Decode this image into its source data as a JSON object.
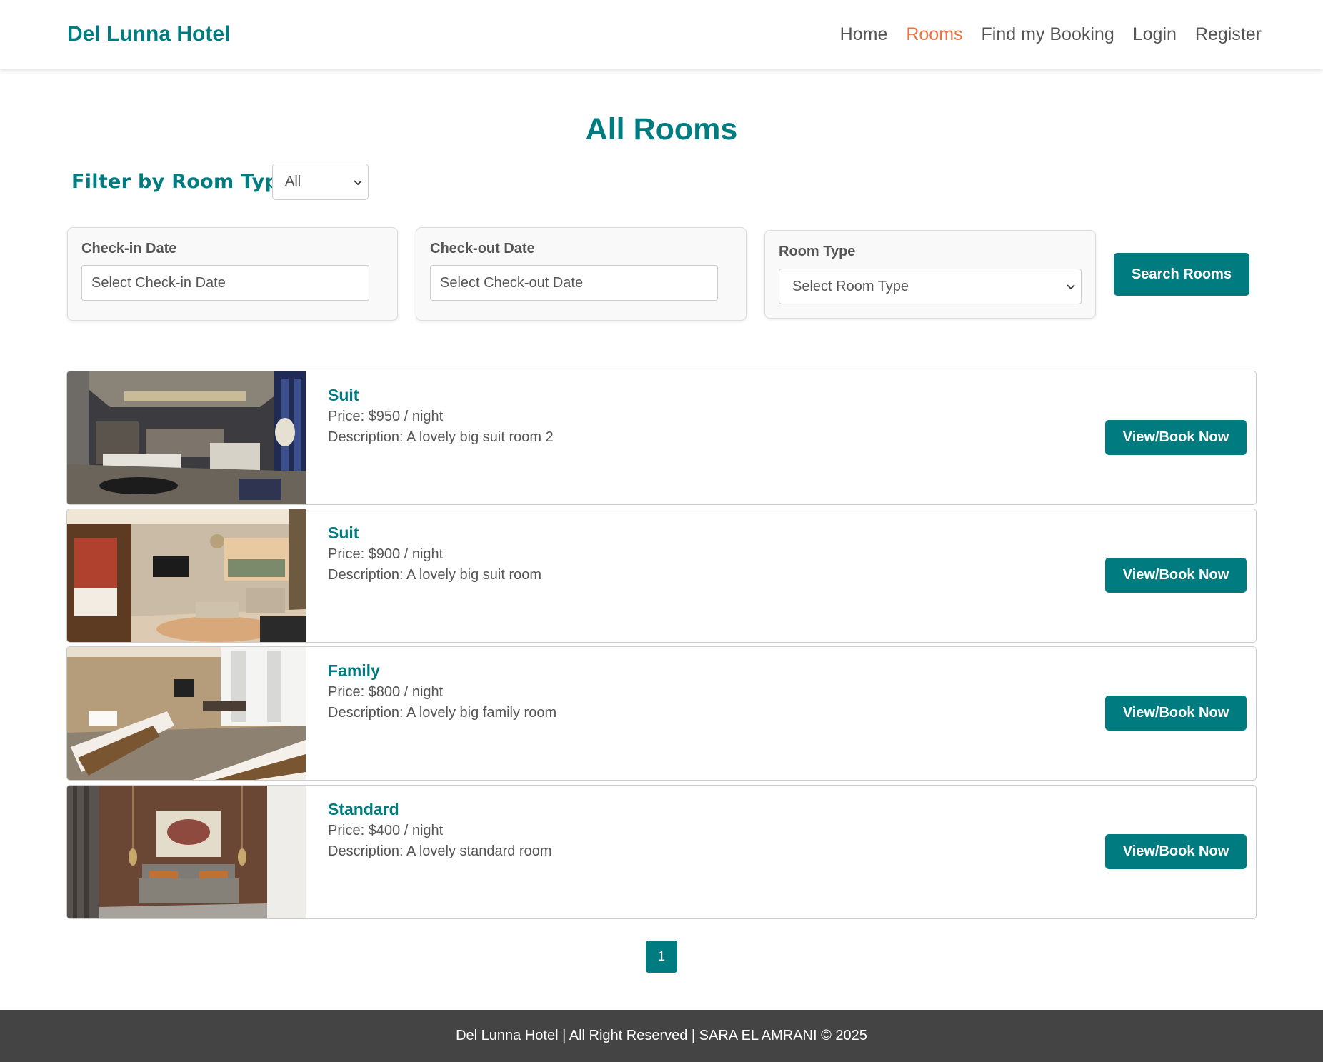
{
  "navbar": {
    "brand": "Del Lunna Hotel",
    "links": [
      {
        "label": "Home",
        "active": false
      },
      {
        "label": "Rooms",
        "active": true
      },
      {
        "label": "Find my Booking",
        "active": false
      },
      {
        "label": "Login",
        "active": false
      },
      {
        "label": "Register",
        "active": false
      }
    ]
  },
  "page": {
    "title": "All Rooms",
    "filter_label": "Filter by Room Type:",
    "filter_value": "All"
  },
  "search": {
    "checkin_label": "Check-in Date",
    "checkin_placeholder": "Select Check-in Date",
    "checkout_label": "Check-out Date",
    "checkout_placeholder": "Select Check-out Date",
    "roomtype_label": "Room Type",
    "roomtype_placeholder": "Select Room Type",
    "button": "Search Rooms"
  },
  "rooms": [
    {
      "name": "Suit",
      "price": "Price: $950 / night",
      "description": "Description: A lovely big suit room 2",
      "button": "View/Book Now"
    },
    {
      "name": "Suit",
      "price": "Price: $900 / night",
      "description": "Description: A lovely big suit room",
      "button": "View/Book Now"
    },
    {
      "name": "Family",
      "price": "Price: $800 / night",
      "description": "Description: A lovely big family room",
      "button": "View/Book Now"
    },
    {
      "name": "Standard",
      "price": "Price: $400 / night",
      "description": "Description: A lovely standard room",
      "button": "View/Book Now"
    }
  ],
  "pagination": {
    "current": "1"
  },
  "footer": {
    "text": "Del Lunna Hotel | All Right Reserved | SARA EL AMRANI © 2025"
  },
  "colors": {
    "brand": "#007c80",
    "active_link": "#f0703e",
    "footer_bg": "#444444"
  }
}
